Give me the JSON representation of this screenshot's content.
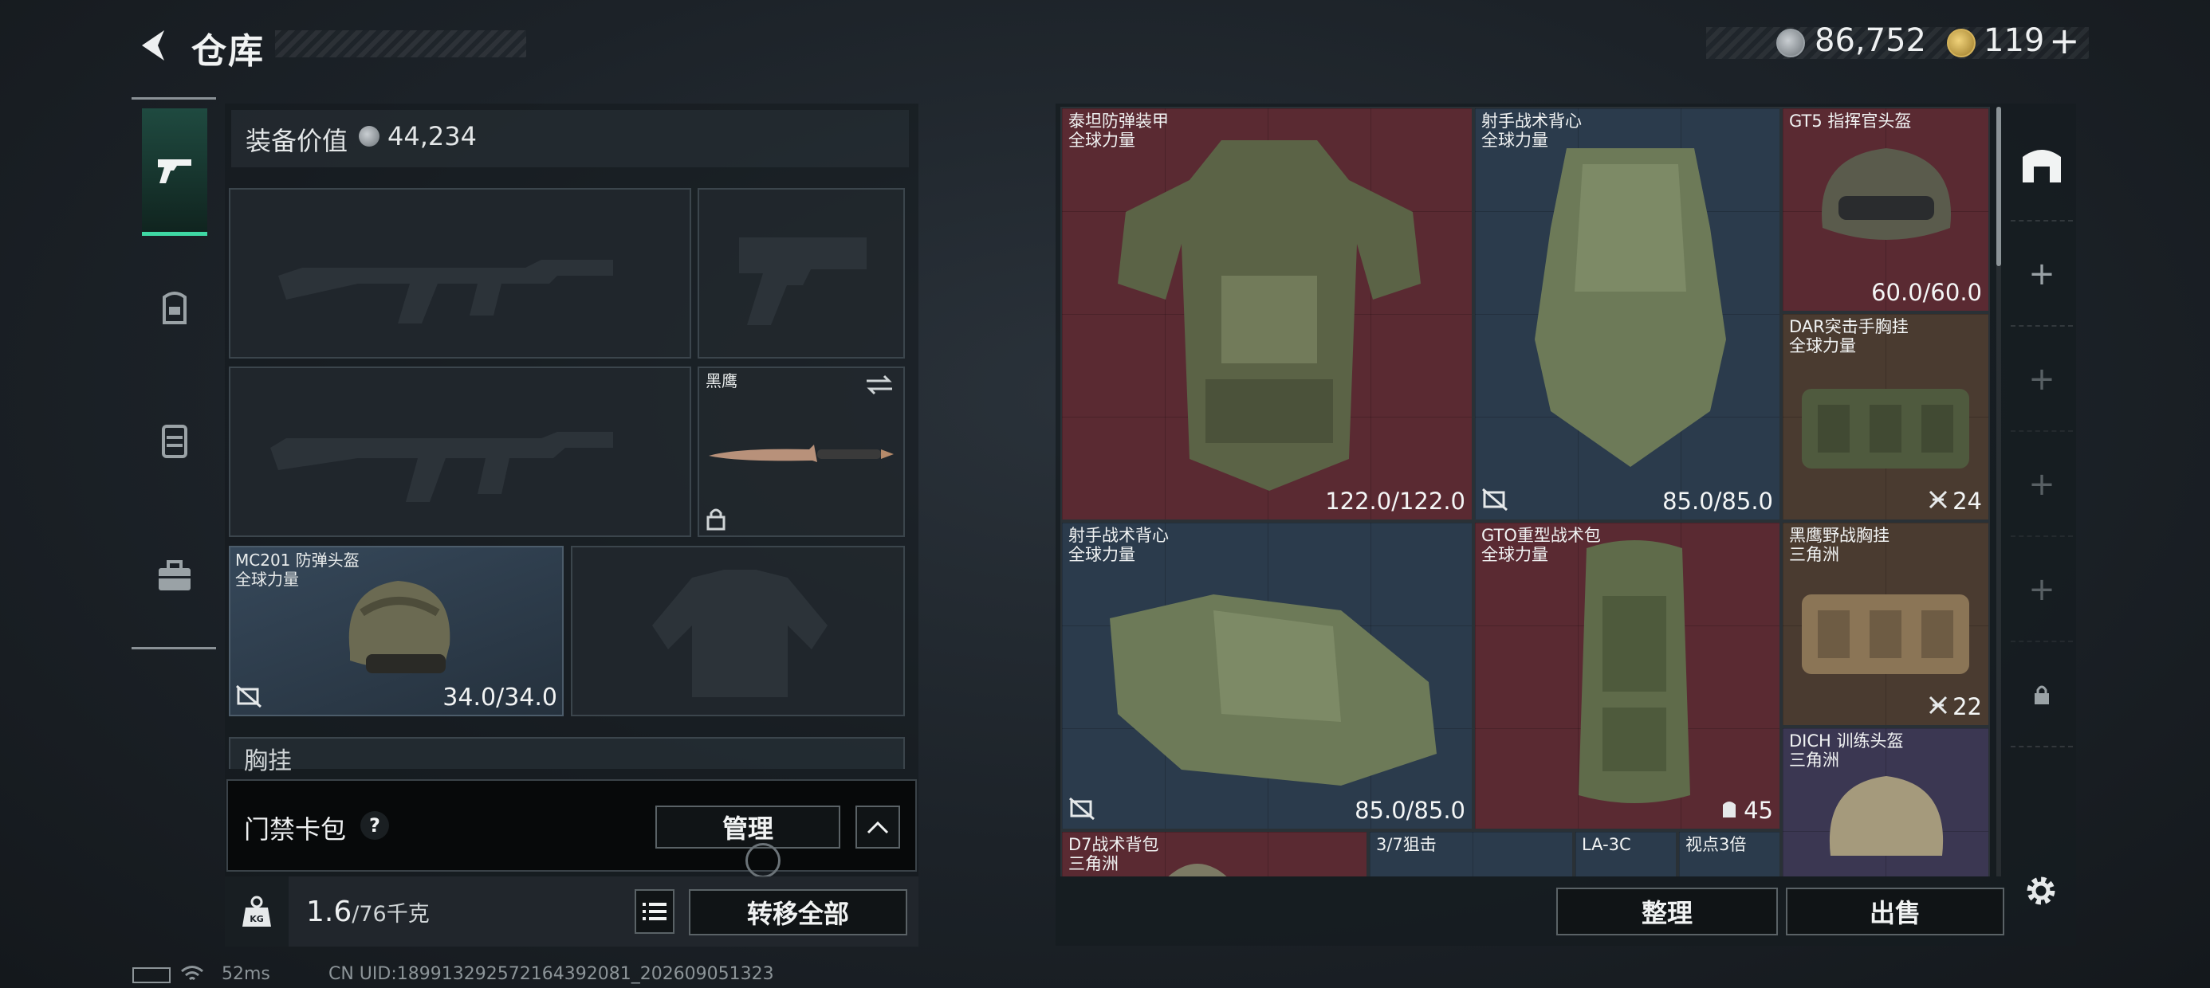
{
  "header": {
    "title": "仓库",
    "silver_amount": "86,752",
    "gold_amount": "119",
    "gold_plus": "+"
  },
  "left_panel": {
    "value_label": "装备价值",
    "value_amount": "44,234",
    "knife": {
      "name": "黑鹰"
    },
    "helmet": {
      "name": "MC201 防弹头盔",
      "region": "全球力量",
      "durability": "34.0/34.0"
    },
    "chest_label": "胸挂",
    "chest_help": "?",
    "card_pack": {
      "label": "门禁卡包",
      "help": "?",
      "manage_label": "管理"
    },
    "weight": {
      "current": "1.6",
      "max": "/76千克"
    },
    "transfer_all_label": "转移全部"
  },
  "items": [
    {
      "name": "泰坦防弹装甲",
      "region": "全球力量",
      "value": "122.0/122.0"
    },
    {
      "name": "射手战术背心",
      "region": "全球力量",
      "value": "85.0/85.0"
    },
    {
      "name": "GT5 指挥官头盔",
      "region": "",
      "value": "60.0/60.0"
    },
    {
      "name": "DAR突击手胸挂",
      "region": "全球力量",
      "value": "24"
    },
    {
      "name": "射手战术背心",
      "region": "全球力量",
      "value": "85.0/85.0"
    },
    {
      "name": "GTO重型战术包",
      "region": "全球力量",
      "value": "45"
    },
    {
      "name": "黑鹰野战胸挂",
      "region": "三角洲",
      "value": "22"
    },
    {
      "name": "DICH 训练头盔",
      "region": "三角洲",
      "value": ""
    },
    {
      "name": "D7战术背包",
      "region": "三角洲",
      "value": ""
    },
    {
      "name": "3/7狙击",
      "region": "",
      "value": ""
    },
    {
      "name": "LA-3C",
      "region": "",
      "value": ""
    },
    {
      "name": "视点3倍",
      "region": "",
      "value": ""
    }
  ],
  "actions": {
    "organize_label": "整理",
    "sell_label": "出售"
  },
  "side_add": "+",
  "footer": {
    "ping": "52ms",
    "uid": "CN UID:18991329257216439208​1_202609051323"
  },
  "colors": {
    "accent": "#3fd8a4",
    "red_rarity": "#5a2a32",
    "blue_rarity": "#2b3b4c",
    "brown_rarity": "#4a3b30",
    "purple_rarity": "#3b3752"
  }
}
